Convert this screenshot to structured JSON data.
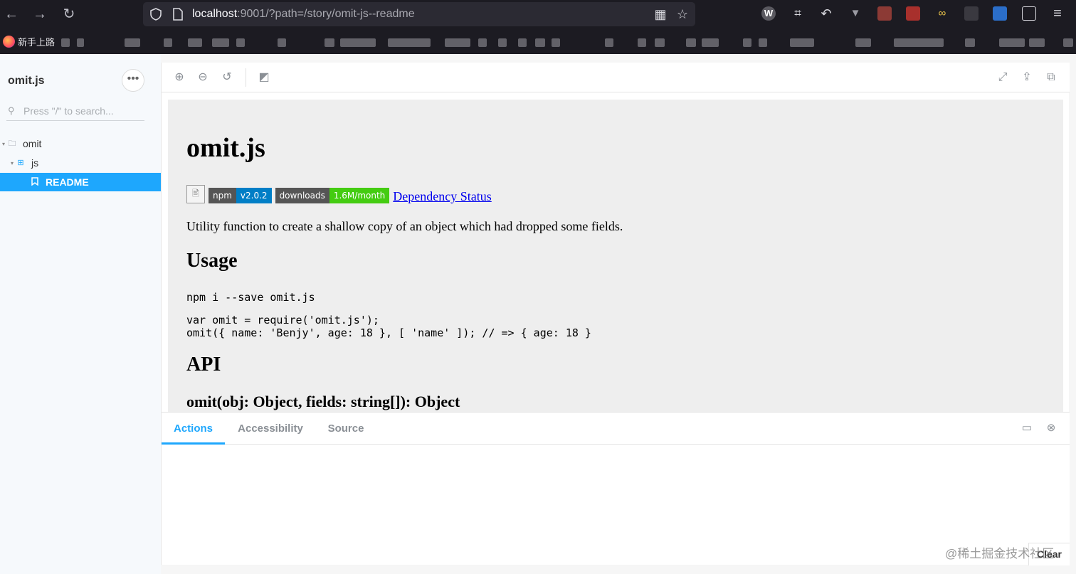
{
  "browser": {
    "url_host": "localhost",
    "url_rest": ":9001/?path=/story/omit-js--readme",
    "bookmark_first": "新手上路",
    "nav": {
      "back": "←",
      "forward": "→",
      "reload": "↻"
    },
    "url_icons": {
      "qr": "▦",
      "star": "☆"
    },
    "ext_icons": {
      "wordpress": "W",
      "crop": "⌗",
      "undo": "↶",
      "vuetify": "▼",
      "infinity": "∞",
      "menu": "≡"
    }
  },
  "sidebar": {
    "title": "omit.js",
    "menu_glyph": "•••",
    "search_placeholder": "Press \"/\" to search...",
    "tree": [
      {
        "label": "omit",
        "icon": "folder-icon"
      },
      {
        "label": "js",
        "icon": "component-icon"
      },
      {
        "label": "README",
        "icon": "bookmark-icon"
      }
    ],
    "icon_glyphs": {
      "caret": "▾",
      "folder": "🗀",
      "component": "⊞",
      "bookmark": "🔖",
      "search": "⚲"
    }
  },
  "toolbar": {
    "zoom_in": "⊕",
    "zoom_out": "⊖",
    "reset_zoom": "↺",
    "background": "◩",
    "fullscreen": "⤢",
    "share": "⇪",
    "copy": "⧉"
  },
  "readme": {
    "title": "omit.js",
    "broken_image": "🖹",
    "badges": [
      {
        "label": "npm",
        "value": "v2.0.2",
        "color": "#007ec6"
      },
      {
        "label": "downloads",
        "value": "1.6M/month",
        "color": "#4c1"
      }
    ],
    "dependency_link": "Dependency Status",
    "intro": "Utility function to create a shallow copy of an object which had dropped some fields.",
    "usage_heading": "Usage",
    "install_cmd": "npm i --save omit.js",
    "code_line1": "var omit = require('omit.js');",
    "code_line2": "omit({ name: 'Benjy', age: 18 }, [ 'name' ]); // => { age: 18 }",
    "api_heading": "API",
    "signature": "omit(obj: Object, fields: string[]): Object"
  },
  "panel": {
    "tabs": [
      "Actions",
      "Accessibility",
      "Source"
    ],
    "active_tab": "Actions",
    "layout_icon": "▭",
    "close_icon": "⊗",
    "clear_label": "Clear"
  },
  "watermark": "@稀土掘金技术社区",
  "colors": {
    "accent": "#1ea7fd",
    "chrome": "#1c1b22"
  }
}
